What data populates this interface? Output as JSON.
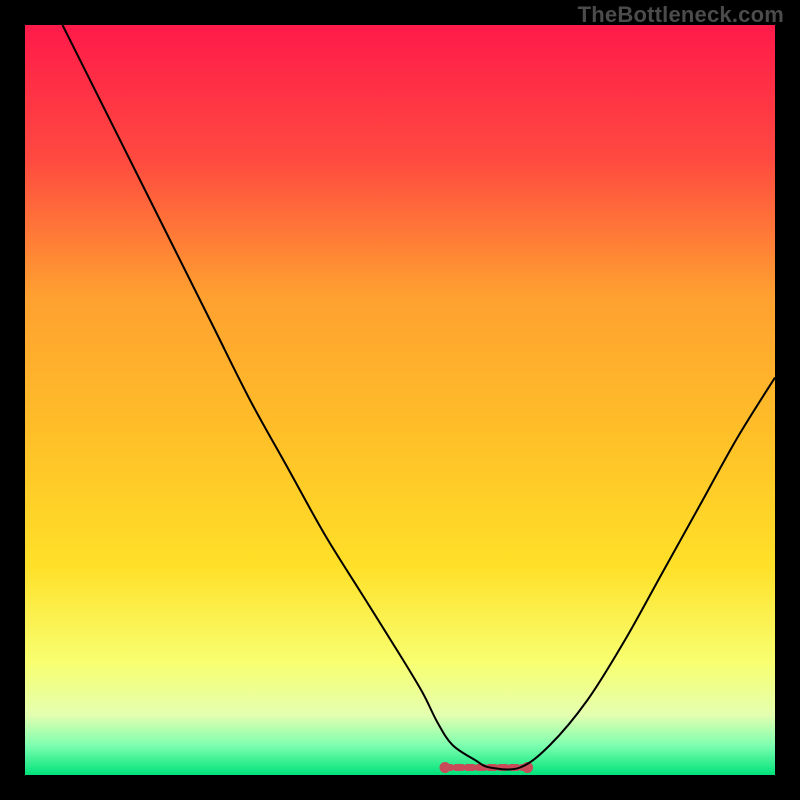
{
  "watermark": "TheBottleneck.com",
  "colors": {
    "bg_outer": "#000000",
    "grad_top": "#ff1a4a",
    "grad_mid1": "#ff5a3c",
    "grad_mid2": "#ffa030",
    "grad_mid3": "#ffe028",
    "grad_bottom1": "#f7ff60",
    "grad_bottom2": "#e4ffb0",
    "grad_bottom3": "#7fffb0",
    "grad_bottom4": "#00e27a",
    "curve": "#000000",
    "marker": "#c94a58"
  },
  "chart_data": {
    "type": "line",
    "title": "",
    "xlabel": "",
    "ylabel": "",
    "xlim": [
      0,
      100
    ],
    "ylim": [
      0,
      100
    ],
    "series": [
      {
        "name": "curve",
        "x": [
          5,
          10,
          15,
          20,
          25,
          30,
          35,
          40,
          45,
          50,
          53,
          55,
          57,
          60,
          62,
          66,
          70,
          75,
          80,
          85,
          90,
          95,
          100
        ],
        "y": [
          100,
          90,
          80,
          70,
          60,
          50,
          41,
          32,
          24,
          16,
          11,
          7,
          4,
          2,
          1,
          1,
          4,
          10,
          18,
          27,
          36,
          45,
          53
        ]
      }
    ],
    "trough_markers": {
      "x_start": 56,
      "x_end": 67,
      "y": 1
    }
  }
}
